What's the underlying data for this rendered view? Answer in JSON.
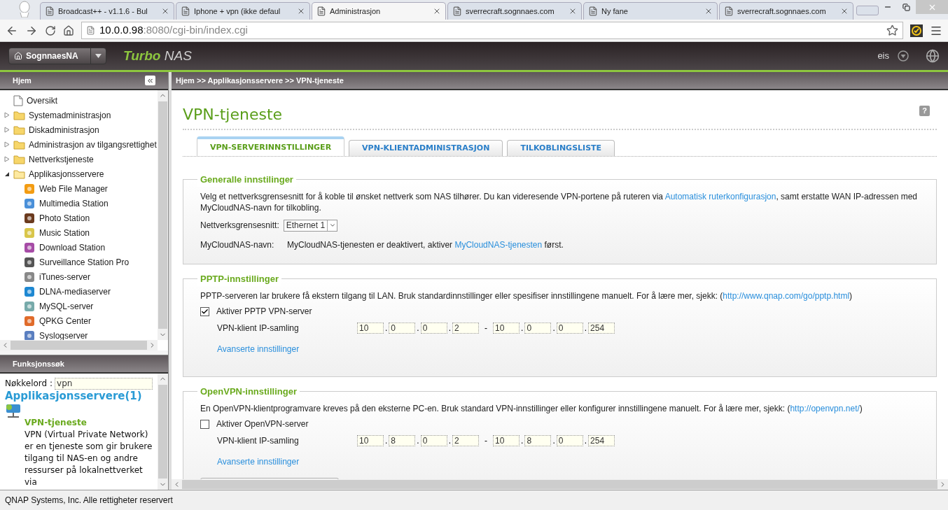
{
  "browser": {
    "tabs": [
      {
        "title": "Broadcast++ - v1.1.6 - Bul",
        "selected": false
      },
      {
        "title": "Iphone + vpn (ikke defaul",
        "selected": false
      },
      {
        "title": "Administrasjon",
        "selected": true
      },
      {
        "title": "sverrecraft.sognnaes.com",
        "selected": false
      },
      {
        "title": "Ny fane",
        "selected": false
      },
      {
        "title": "sverrecraft.sognnaes.com",
        "selected": false
      }
    ],
    "url": {
      "host": "10.0.0.98",
      "rest": ":8080/cgi-bin/index.cgi"
    }
  },
  "nas": {
    "device": "SognnaesNA",
    "brand_bold": "Turbo",
    "brand_rest": "NAS",
    "user": "eis"
  },
  "sidebar": {
    "title": "Hjem",
    "items": [
      {
        "label": "Oversikt",
        "kind": "page"
      },
      {
        "label": "Systemadministrasjon",
        "kind": "folder",
        "expanded": false
      },
      {
        "label": "Diskadministrasjon",
        "kind": "folder",
        "expanded": false
      },
      {
        "label": "Administrasjon av tilgangsrettighet",
        "kind": "folder",
        "expanded": false
      },
      {
        "label": "Nettverkstjeneste",
        "kind": "folder",
        "expanded": false
      },
      {
        "label": "Applikasjonsservere",
        "kind": "folder",
        "expanded": true,
        "children": [
          {
            "label": "Web File Manager"
          },
          {
            "label": "Multimedia Station"
          },
          {
            "label": "Photo Station"
          },
          {
            "label": "Music Station"
          },
          {
            "label": "Download Station"
          },
          {
            "label": "Surveillance Station Pro"
          },
          {
            "label": "iTunes-server"
          },
          {
            "label": "DLNA-mediaserver"
          },
          {
            "label": "MySQL-server"
          },
          {
            "label": "QPKG Center"
          },
          {
            "label": "Syslogserver"
          }
        ]
      }
    ]
  },
  "search": {
    "title": "Funksjonssøk",
    "keyword_label": "Nøkkelord :",
    "keyword": "vpn",
    "group": "Applikasjonsservere(1)",
    "result_title": "VPN-tjeneste",
    "result_text": "VPN (Virtual Private Network) er en tjeneste som gir brukere tilgang til NAS-en og andre ressurser på lokalnettverket via"
  },
  "footer": "QNAP Systems, Inc. Alle rettigheter reservert",
  "content": {
    "breadcrumb": "Hjem >> Applikasjonsservere >> VPN-tjeneste",
    "title": "VPN-tjeneste",
    "help": "?",
    "tabs": [
      {
        "label": "VPN-SERVERINNSTILLINGER",
        "selected": true
      },
      {
        "label": "VPN-KLIENTADMINISTRASJON",
        "selected": false
      },
      {
        "label": "TILKOBLINGSLISTE",
        "selected": false
      }
    ],
    "general": {
      "legend": "Generalle innstilinger",
      "text_before": "Velg et nettverksgrensesnitt for å koble til ønsket nettverk som NAS tilhører. Du kan videresende VPN-portene på ruteren via ",
      "link": "Automatisk ruterkonfigurasjon",
      "text_after": ", samt erstatte WAN IP-adressen med MyCloudNAS-navn for tilkobling.",
      "interface_label": "Nettverksgrensesnitt:",
      "interface_value": "Ethernet 1",
      "cloud_label": "MyCloudNAS-navn:",
      "cloud_before": "MyCloudNAS-tjenesten er deaktivert, aktiver ",
      "cloud_link": "MyCloudNAS-tjenesten",
      "cloud_after": " først."
    },
    "sections": [
      {
        "legend": "PPTP-innstillinger",
        "text_before": "PPTP-serveren lar brukere få ekstern tilgang til LAN. Bruk standardinnstillinger eller spesifiser innstillingene manuelt. For å lære mer, sjekk: (",
        "link": "http://www.qnap.com/go/pptp.html",
        "text_after": ")",
        "enable_label": "Aktiver PPTP VPN-server",
        "checked": true,
        "pool_label": "VPN-klient IP-samling",
        "start": [
          "10",
          "0",
          "0",
          "2"
        ],
        "end": [
          "10",
          "0",
          "0",
          "254"
        ],
        "dot": ".",
        "dash": "-",
        "advanced": "Avanserte innstillinger",
        "has_button": false
      },
      {
        "legend": "OpenVPN-innstillinger",
        "text_before": "En OpenVPN-klientprogramvare kreves på den eksterne PC-en. Bruk standard VPN-innstillinger eller konfigurer innstillingene manuelt. For å lære mer, sjekk: (",
        "link": "http://openvpn.net/",
        "text_after": ")",
        "enable_label": "Aktiver OpenVPN-server",
        "checked": false,
        "pool_label": "VPN-klient IP-samling",
        "start": [
          "10",
          "8",
          "0",
          "2"
        ],
        "end": [
          "10",
          "8",
          "0",
          "254"
        ],
        "dot": ".",
        "dash": "-",
        "advanced": "Avanserte innstillinger",
        "has_button": true
      }
    ]
  }
}
